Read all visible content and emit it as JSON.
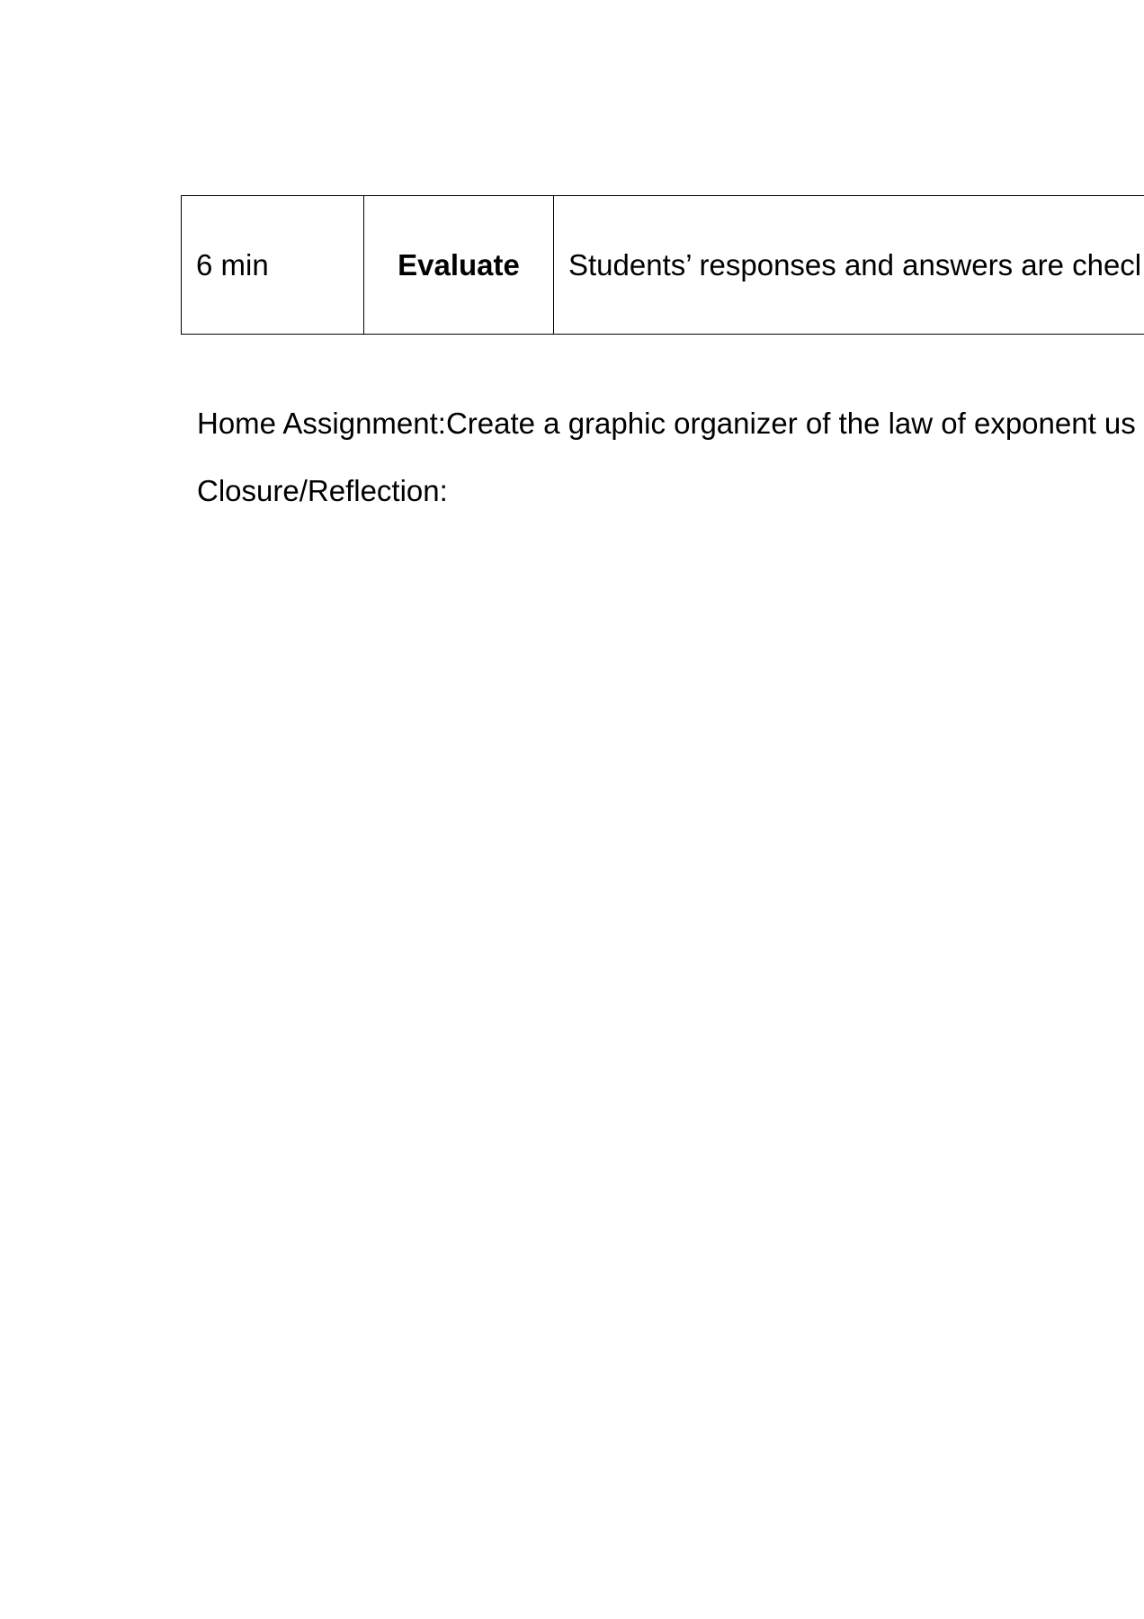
{
  "table": {
    "rows": [
      {
        "time": "6 min",
        "phase": "Evaluate",
        "description": "Students’ responses and answers are checl"
      }
    ]
  },
  "home_assignment": {
    "label": "Home Assignment:",
    "text": "Create a graphic organizer of the law of exponent us"
  },
  "closure": {
    "label": "Closure/Reflection:"
  }
}
